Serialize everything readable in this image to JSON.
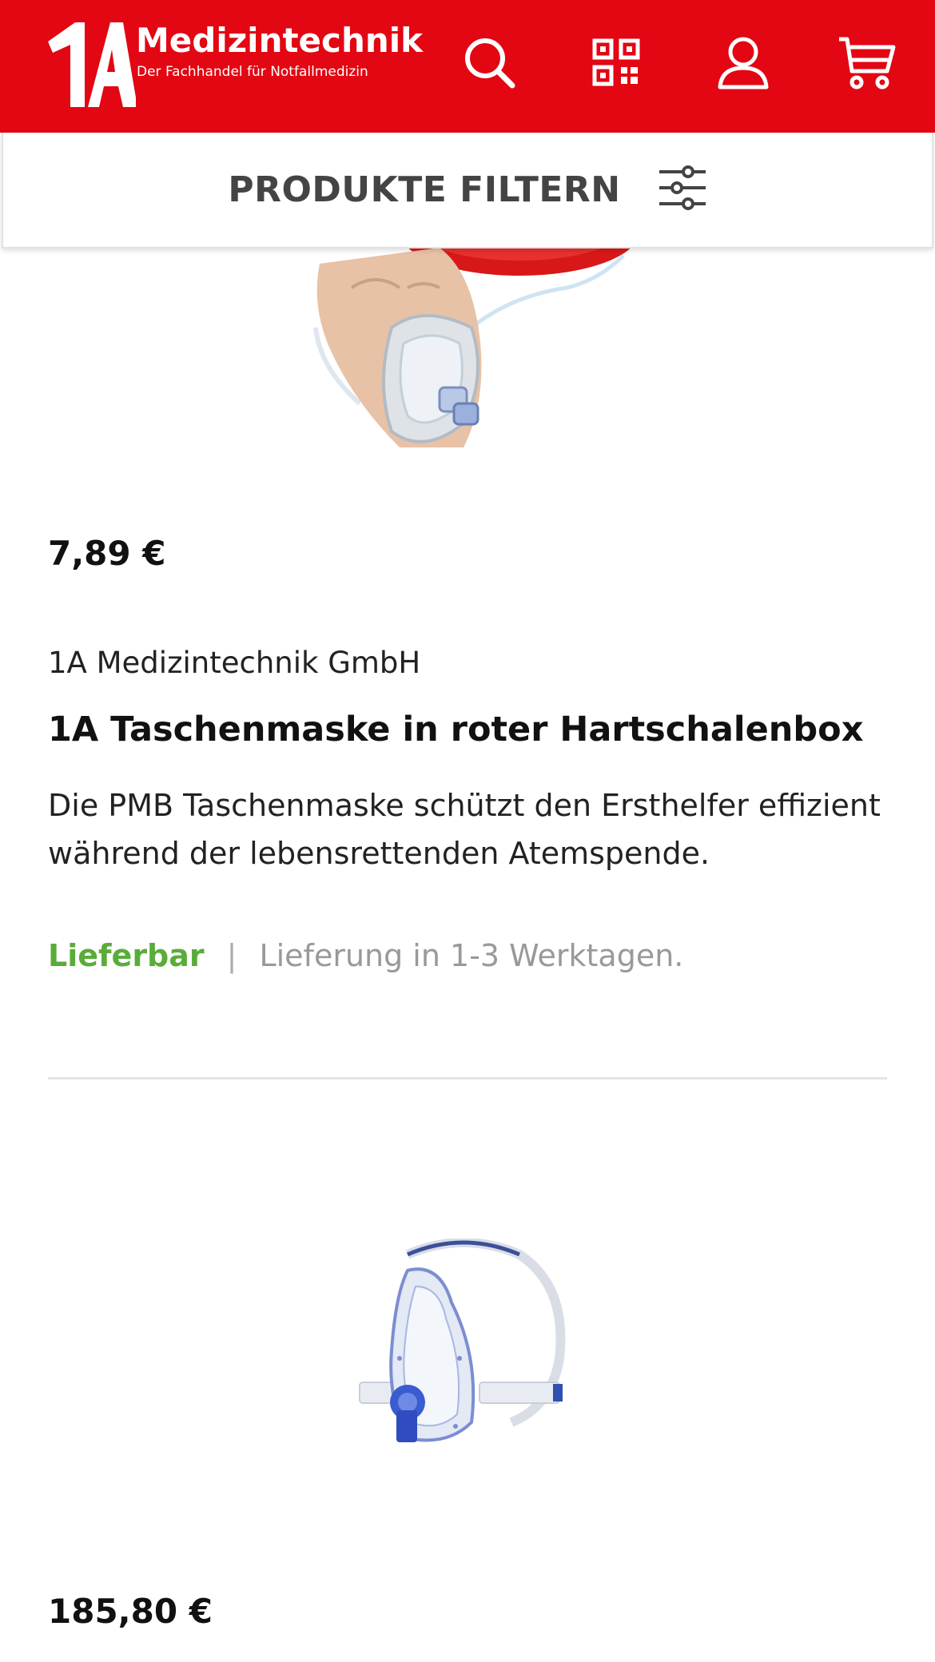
{
  "header": {
    "logo_mark": "1A",
    "brand_name": "Medizintechnik",
    "brand_tagline": "Der Fachhandel für Notfallmedizin",
    "brand_color": "#e30613",
    "icons": [
      "search-icon",
      "qr-code-icon",
      "user-icon",
      "cart-icon"
    ]
  },
  "filter": {
    "label": "PRODUKTE FILTERN",
    "icon": "sliders-icon"
  },
  "products": [
    {
      "image_icon": "pocket-mask-image",
      "price": "7,89 €",
      "manufacturer": "1A Medizintechnik GmbH",
      "title": "1A Taschenmaske in roter Hartschalenbox",
      "description": "Die PMB Taschenmaske schützt den Ersthelfer effizient während der lebensrettenden Atemspende.",
      "availability": "Lieferbar",
      "separator": "|",
      "delivery": "Lieferung in 1-3 Werktagen.",
      "availability_color": "#5aac3a"
    },
    {
      "image_icon": "ventilation-mask-image",
      "price": "185,80 €"
    }
  ]
}
